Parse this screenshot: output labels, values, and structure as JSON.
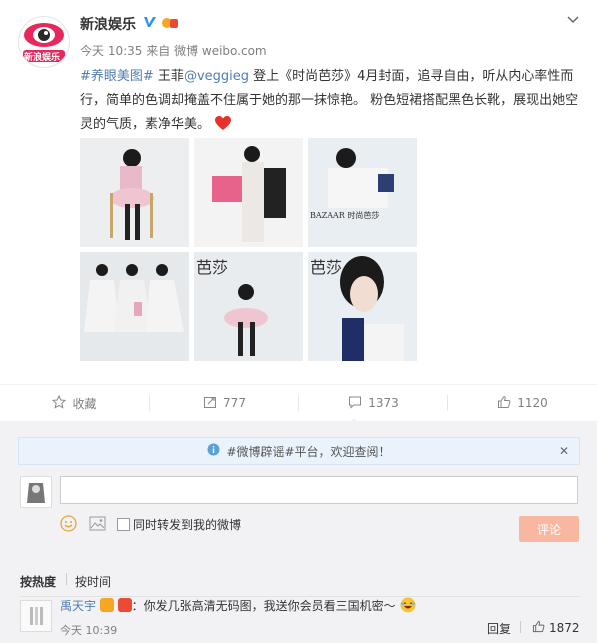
{
  "post": {
    "author": "新浪娱乐",
    "time": "今天 10:35",
    "source_prefix": "来自",
    "source": "微博 weibo.com",
    "hashtag": "#养眼美图#",
    "text_1": " 王菲",
    "mention": "@veggieg",
    "text_2": " 登上《时尚芭莎》4月封面，追寻自由，听从内心率性而行，简单的色调却掩盖不住属于她的那一抹惊艳。 粉色短裙搭配黑色长靴，展现出她空灵的气质，素净华美。",
    "avatar_text": "新浪娱乐",
    "images": [
      {
        "label": ""
      },
      {
        "label": ""
      },
      {
        "label": "BAZAAR 时尚芭莎"
      },
      {
        "label": ""
      },
      {
        "label": "芭莎"
      },
      {
        "label": "芭莎"
      }
    ]
  },
  "actions": {
    "favorite": "收藏",
    "repost": "777",
    "comment": "1373",
    "like": "1120"
  },
  "comment_box": {
    "notice": "#微博辟谣#平台，欢迎查阅！",
    "checkbox_label": "同时转发到我的微博",
    "submit": "评论"
  },
  "sort": {
    "hot": "按热度",
    "time": "按时间"
  },
  "comment": {
    "user": "禹天宇",
    "text": "：你发几张高清无码图，我送你会员看三国机密～",
    "time": "今天 10:39",
    "reply": "回复",
    "likes": "1872"
  },
  "colors": {
    "accent": "#eb7350",
    "link": "#507daf",
    "verified": "#2a93f0"
  }
}
